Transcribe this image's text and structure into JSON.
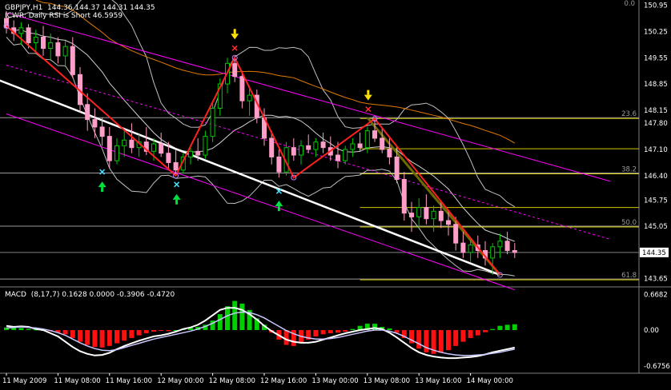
{
  "header": {
    "symbol_line": "GBPJPY,H1  144.36 144.37 144.31 144.35",
    "indicator_line": "ICWR: Daily RSI is Short 46.5959"
  },
  "macd": {
    "label": "MACD  (8,17,7) 0.1628 0.0000 -0.3906 -0.4720"
  },
  "colors": {
    "background": "#000000",
    "bull_candle": "#00c800",
    "bear_candle": "#ff9ec8",
    "zigzag": "#ff2020",
    "channel": "#ff00ff",
    "trendline": "#ffffff",
    "fibo": "#d4c800",
    "ma_orange": "#e07a00",
    "bollinger": "#c0c0c0",
    "macd_pos": "#00d000",
    "macd_neg": "#ff1010",
    "macd_line": "#ffffff",
    "signal_line": "#c8c8ff"
  },
  "markers": {
    "sell_arrows": [
      "down-arrow-yellow",
      "down-arrow-yellow"
    ],
    "buy_arrows": [
      "up-arrow-green",
      "up-arrow-green",
      "up-arrow-green"
    ]
  },
  "chart_data": [
    {
      "type": "candlestick",
      "title": "GBPJPY,H1",
      "ylim": [
        143.45,
        151.05
      ],
      "y_ticks": [
        "150.95",
        "150.25",
        "149.55",
        "148.85",
        "148.15",
        "147.80",
        "147.10",
        "146.40",
        "145.75",
        "145.05",
        "144.35",
        "143.65"
      ],
      "y_tick_values": [
        150.95,
        150.25,
        149.55,
        148.85,
        148.15,
        147.8,
        147.1,
        146.4,
        145.75,
        145.05,
        144.35,
        143.65
      ],
      "top_label": "0.0",
      "current_price": "144.35",
      "x_labels": [
        "11 May 2009",
        "11 May 08:00",
        "11 May 16:00",
        "12 May 00:00",
        "12 May 08:00",
        "12 May 16:00",
        "13 May 00:00",
        "13 May 08:00",
        "13 May 16:00",
        "14 May 00:00"
      ],
      "fibonacci_levels": [
        {
          "label": "23.6",
          "price": 147.95
        },
        {
          "label": "38.2",
          "price": 146.47
        },
        {
          "label": "50.0",
          "price": 145.05
        },
        {
          "label": "61.8",
          "price": 143.64
        }
      ],
      "extra_yellow_levels": [
        147.12,
        145.55
      ],
      "zigzag_points": [
        [
          0,
          150.4
        ],
        [
          23,
          146.4
        ],
        [
          31,
          149.55
        ],
        [
          39,
          146.35
        ],
        [
          50,
          147.92
        ],
        [
          67,
          143.75
        ]
      ],
      "candles": [
        {
          "o": 150.6,
          "h": 150.8,
          "l": 150.2,
          "c": 150.35
        },
        {
          "o": 150.35,
          "h": 150.55,
          "l": 150.0,
          "c": 150.2
        },
        {
          "o": 150.2,
          "h": 150.5,
          "l": 149.9,
          "c": 150.35
        },
        {
          "o": 150.35,
          "h": 150.45,
          "l": 149.8,
          "c": 149.95
        },
        {
          "o": 149.95,
          "h": 150.3,
          "l": 149.7,
          "c": 150.1
        },
        {
          "o": 150.1,
          "h": 150.4,
          "l": 149.6,
          "c": 149.8
        },
        {
          "o": 149.8,
          "h": 150.2,
          "l": 149.5,
          "c": 149.95
        },
        {
          "o": 149.95,
          "h": 150.1,
          "l": 149.4,
          "c": 149.6
        },
        {
          "o": 149.6,
          "h": 150.0,
          "l": 149.3,
          "c": 149.85
        },
        {
          "o": 149.85,
          "h": 150.1,
          "l": 149.0,
          "c": 149.1
        },
        {
          "o": 149.1,
          "h": 149.3,
          "l": 148.1,
          "c": 148.3
        },
        {
          "o": 148.3,
          "h": 148.6,
          "l": 147.6,
          "c": 147.9
        },
        {
          "o": 147.9,
          "h": 148.2,
          "l": 147.4,
          "c": 147.7
        },
        {
          "o": 147.7,
          "h": 147.95,
          "l": 147.2,
          "c": 147.45
        },
        {
          "o": 147.45,
          "h": 147.7,
          "l": 146.6,
          "c": 146.8
        },
        {
          "o": 146.8,
          "h": 147.4,
          "l": 146.7,
          "c": 147.2
        },
        {
          "o": 147.2,
          "h": 147.6,
          "l": 146.9,
          "c": 147.35
        },
        {
          "o": 147.35,
          "h": 147.8,
          "l": 147.0,
          "c": 147.15
        },
        {
          "o": 147.15,
          "h": 147.5,
          "l": 146.9,
          "c": 147.3
        },
        {
          "o": 147.3,
          "h": 147.7,
          "l": 146.95,
          "c": 147.05
        },
        {
          "o": 147.05,
          "h": 147.4,
          "l": 146.8,
          "c": 147.25
        },
        {
          "o": 147.25,
          "h": 147.55,
          "l": 146.9,
          "c": 147.0
        },
        {
          "o": 147.0,
          "h": 147.3,
          "l": 146.6,
          "c": 146.75
        },
        {
          "o": 146.75,
          "h": 147.1,
          "l": 146.4,
          "c": 146.55
        },
        {
          "o": 146.55,
          "h": 147.0,
          "l": 146.45,
          "c": 146.9
        },
        {
          "o": 146.9,
          "h": 147.2,
          "l": 146.7,
          "c": 147.05
        },
        {
          "o": 147.05,
          "h": 147.4,
          "l": 146.8,
          "c": 146.95
        },
        {
          "o": 146.95,
          "h": 147.6,
          "l": 146.85,
          "c": 147.45
        },
        {
          "o": 147.45,
          "h": 148.4,
          "l": 147.3,
          "c": 148.2
        },
        {
          "o": 148.2,
          "h": 149.0,
          "l": 148.0,
          "c": 148.85
        },
        {
          "o": 148.85,
          "h": 149.55,
          "l": 148.6,
          "c": 149.4
        },
        {
          "o": 149.4,
          "h": 149.6,
          "l": 148.9,
          "c": 149.05
        },
        {
          "o": 149.05,
          "h": 149.2,
          "l": 148.2,
          "c": 148.4
        },
        {
          "o": 148.4,
          "h": 148.8,
          "l": 148.0,
          "c": 148.55
        },
        {
          "o": 148.55,
          "h": 148.7,
          "l": 147.8,
          "c": 147.95
        },
        {
          "o": 147.95,
          "h": 148.2,
          "l": 147.2,
          "c": 147.4
        },
        {
          "o": 147.4,
          "h": 147.6,
          "l": 146.7,
          "c": 146.9
        },
        {
          "o": 146.9,
          "h": 147.1,
          "l": 146.35,
          "c": 146.5
        },
        {
          "o": 146.5,
          "h": 147.3,
          "l": 146.4,
          "c": 147.15
        },
        {
          "o": 147.15,
          "h": 147.4,
          "l": 146.8,
          "c": 146.95
        },
        {
          "o": 146.95,
          "h": 147.35,
          "l": 146.7,
          "c": 147.2
        },
        {
          "o": 147.2,
          "h": 147.5,
          "l": 147.0,
          "c": 147.1
        },
        {
          "o": 147.1,
          "h": 147.4,
          "l": 146.9,
          "c": 147.3
        },
        {
          "o": 147.3,
          "h": 147.55,
          "l": 147.0,
          "c": 147.15
        },
        {
          "o": 147.15,
          "h": 147.45,
          "l": 146.8,
          "c": 146.95
        },
        {
          "o": 146.95,
          "h": 147.3,
          "l": 146.6,
          "c": 146.8
        },
        {
          "o": 146.8,
          "h": 147.2,
          "l": 146.7,
          "c": 147.1
        },
        {
          "o": 147.1,
          "h": 147.4,
          "l": 146.9,
          "c": 147.25
        },
        {
          "o": 147.25,
          "h": 147.55,
          "l": 147.05,
          "c": 147.15
        },
        {
          "o": 147.15,
          "h": 147.7,
          "l": 147.0,
          "c": 147.6
        },
        {
          "o": 147.6,
          "h": 147.95,
          "l": 147.3,
          "c": 147.4
        },
        {
          "o": 147.4,
          "h": 147.7,
          "l": 147.0,
          "c": 147.1
        },
        {
          "o": 147.1,
          "h": 147.4,
          "l": 146.7,
          "c": 146.9
        },
        {
          "o": 146.9,
          "h": 147.2,
          "l": 146.2,
          "c": 146.3
        },
        {
          "o": 146.3,
          "h": 146.5,
          "l": 145.2,
          "c": 145.4
        },
        {
          "o": 145.4,
          "h": 145.7,
          "l": 144.9,
          "c": 145.3
        },
        {
          "o": 145.3,
          "h": 145.8,
          "l": 145.0,
          "c": 145.55
        },
        {
          "o": 145.55,
          "h": 145.9,
          "l": 145.1,
          "c": 145.25
        },
        {
          "o": 145.25,
          "h": 145.6,
          "l": 144.9,
          "c": 145.45
        },
        {
          "o": 145.45,
          "h": 145.7,
          "l": 145.0,
          "c": 145.2
        },
        {
          "o": 145.2,
          "h": 145.5,
          "l": 144.8,
          "c": 145.1
        },
        {
          "o": 145.1,
          "h": 145.3,
          "l": 144.4,
          "c": 144.6
        },
        {
          "o": 144.6,
          "h": 144.9,
          "l": 144.2,
          "c": 144.35
        },
        {
          "o": 144.35,
          "h": 144.7,
          "l": 144.1,
          "c": 144.55
        },
        {
          "o": 144.55,
          "h": 144.8,
          "l": 144.2,
          "c": 144.4
        },
        {
          "o": 144.4,
          "h": 144.65,
          "l": 144.0,
          "c": 144.2
        },
        {
          "o": 144.2,
          "h": 144.6,
          "l": 143.75,
          "c": 144.5
        },
        {
          "o": 144.5,
          "h": 144.85,
          "l": 144.2,
          "c": 144.65
        },
        {
          "o": 144.65,
          "h": 144.9,
          "l": 144.3,
          "c": 144.4
        },
        {
          "o": 144.4,
          "h": 144.6,
          "l": 144.2,
          "c": 144.35
        }
      ]
    },
    {
      "type": "bar",
      "title": "MACD (8,17,7)",
      "ylim": [
        -0.8,
        0.8
      ],
      "y_ticks": [
        "0.6682",
        "0.00",
        "-0.6756"
      ],
      "y_tick_values": [
        0.6682,
        0.0,
        -0.6756
      ],
      "series": [
        {
          "values": [
            0.05,
            0.06,
            0.04,
            0.02,
            0.01,
            0.0,
            -0.02,
            -0.05,
            -0.08,
            -0.15,
            -0.22,
            -0.28,
            -0.32,
            -0.33,
            -0.3,
            -0.25,
            -0.2,
            -0.15,
            -0.1,
            -0.06,
            -0.03,
            -0.01,
            -0.02,
            0.0,
            0.02,
            0.04,
            0.06,
            0.1,
            0.18,
            0.3,
            0.45,
            0.55,
            0.5,
            0.38,
            0.22,
            0.1,
            -0.05,
            -0.18,
            -0.28,
            -0.3,
            -0.25,
            -0.18,
            -0.12,
            -0.08,
            -0.06,
            -0.05,
            -0.03,
            0.02,
            0.08,
            0.12,
            0.12,
            0.06,
            0.03,
            -0.05,
            -0.15,
            -0.25,
            -0.35,
            -0.42,
            -0.45,
            -0.43,
            -0.38,
            -0.3,
            -0.22,
            -0.15,
            -0.1,
            -0.04,
            0.02,
            0.08,
            0.1,
            0.11
          ]
        },
        {
          "values": [
            0.08,
            0.06,
            0.07,
            0.06,
            0.02,
            0.0,
            -0.06,
            -0.12,
            -0.22,
            -0.32,
            -0.4,
            -0.45,
            -0.48,
            -0.47,
            -0.43,
            -0.36,
            -0.3,
            -0.25,
            -0.2,
            -0.16,
            -0.12,
            -0.1,
            -0.07,
            -0.03,
            0.02,
            0.05,
            0.1,
            0.18,
            0.28,
            0.38,
            0.42,
            0.42,
            0.38,
            0.3,
            0.2,
            0.08,
            -0.02,
            -0.1,
            -0.18,
            -0.22,
            -0.24,
            -0.24,
            -0.22,
            -0.18,
            -0.14,
            -0.1,
            -0.06,
            -0.03,
            0.0,
            0.02,
            0.04,
            0.02,
            -0.05,
            -0.14,
            -0.24,
            -0.34,
            -0.42,
            -0.47,
            -0.5,
            -0.52,
            -0.53,
            -0.53,
            -0.52,
            -0.51,
            -0.49,
            -0.46,
            -0.42,
            -0.39,
            -0.36,
            -0.33
          ]
        },
        {
          "values": [
            0.04,
            0.05,
            0.06,
            0.05,
            0.04,
            0.02,
            -0.01,
            -0.05,
            -0.1,
            -0.17,
            -0.24,
            -0.3,
            -0.35,
            -0.38,
            -0.39,
            -0.37,
            -0.33,
            -0.29,
            -0.25,
            -0.21,
            -0.17,
            -0.14,
            -0.11,
            -0.08,
            -0.05,
            -0.02,
            0.02,
            0.07,
            0.13,
            0.2,
            0.27,
            0.32,
            0.34,
            0.33,
            0.29,
            0.23,
            0.15,
            0.07,
            -0.01,
            -0.07,
            -0.12,
            -0.15,
            -0.17,
            -0.17,
            -0.16,
            -0.14,
            -0.11,
            -0.08,
            -0.05,
            -0.02,
            0.0,
            0.0,
            -0.02,
            -0.06,
            -0.12,
            -0.19,
            -0.26,
            -0.33,
            -0.38,
            -0.42,
            -0.45,
            -0.47,
            -0.48,
            -0.48,
            -0.47,
            -0.46,
            -0.44,
            -0.42,
            -0.39,
            -0.36
          ]
        }
      ]
    }
  ]
}
